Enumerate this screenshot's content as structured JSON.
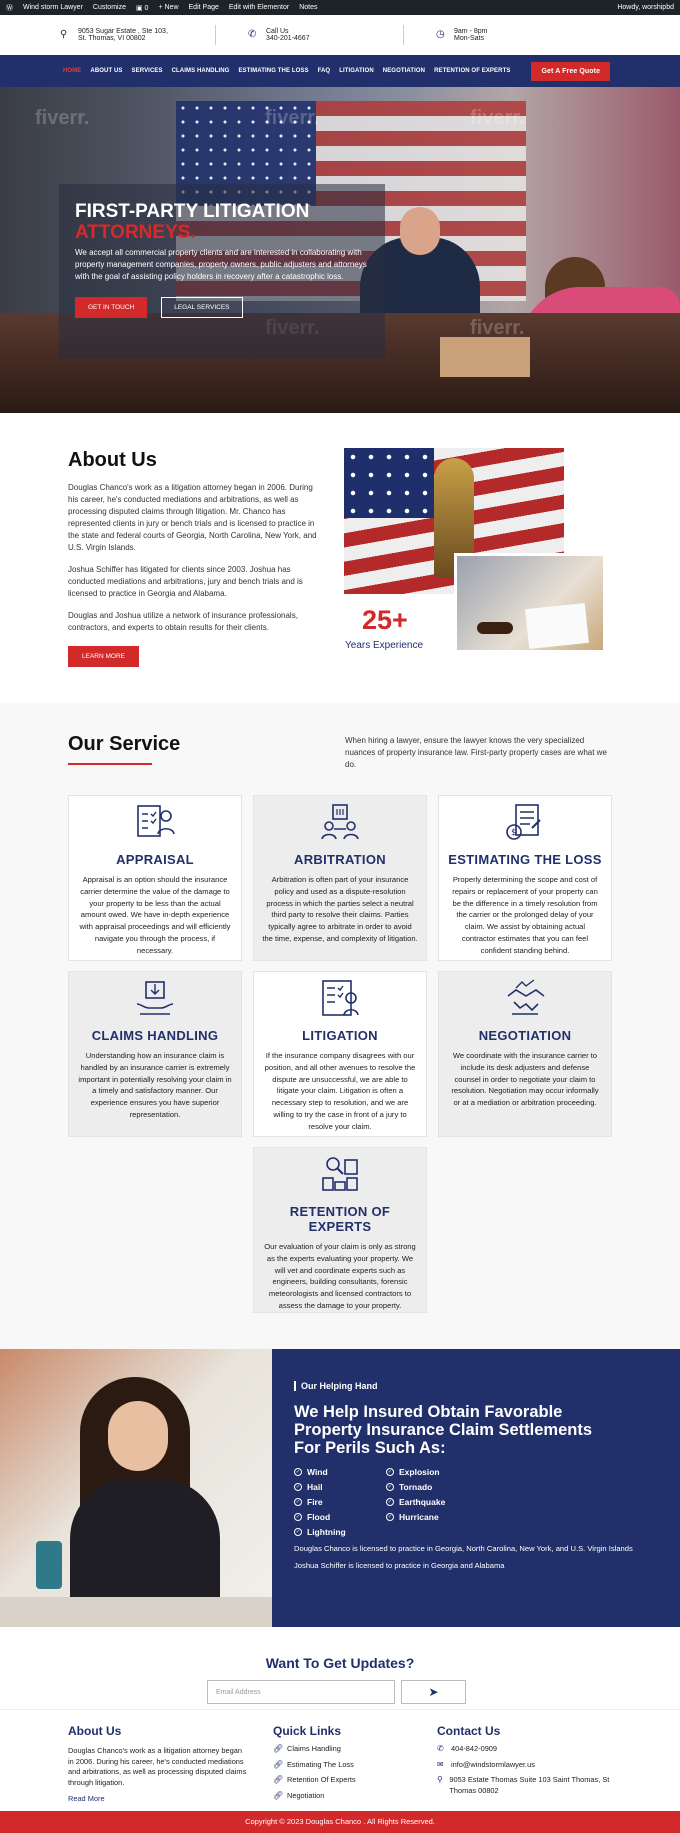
{
  "admin_bar": {
    "site_name": "Wind storm Lawyer",
    "customize": "Customize",
    "comments_count": "0",
    "new": "New",
    "edit_page": "Edit Page",
    "elementor": "Edit with Elementor",
    "notes": "Notes",
    "greeting": "Howdy, worshipbd"
  },
  "topbar": {
    "address_line1": "9053 Sugar Estate , Ste 103,",
    "address_line2": "St. Thomas, VI 00802",
    "call_label": "Call Us",
    "phone": "340-201-4667",
    "hours_line1": "9am - 8pm",
    "hours_line2": "Mon-Sats"
  },
  "nav": {
    "items": [
      "HOME",
      "ABOUT US",
      "SERVICES",
      "CLAIMS HANDLING",
      "ESTIMATING THE LOSS",
      "FAQ",
      "LITIGATION",
      "NEGOTIATION",
      "RETENTION OF EXPERTS"
    ],
    "cta": "Get A Free Quote"
  },
  "hero": {
    "title_line1": "FIRST-PARTY LITIGATION",
    "title_line2": "ATTORNEYS.",
    "text": "We accept all commercial property clients and are interested in collaborating with property management companies, property owners, public adjusters and attorneys with the goal of assisting policy holders in recovery after a catastrophic loss.",
    "btn_primary": "GET IN TOUCH",
    "btn_secondary": "LEGAL SERVICES"
  },
  "about": {
    "title": "About Us",
    "p1": "Douglas Chanco's work as a litigation attorney began in 2006. During his career, he's conducted mediations and arbitrations, as well as processing disputed claims through litigation. Mr. Chanco has represented clients in jury or bench trials and is licensed to practice in the state and federal courts of Georgia, North Carolina, New York, and U.S. Virgin Islands.",
    "p2": "Joshua Schiffer has litigated for clients since 2003. Joshua has conducted mediations and arbitrations, jury and bench trials and is licensed to practice in Georgia and Alabama.",
    "p3": "Douglas and Joshua utilize a network of insurance professionals, contractors, and experts to obtain results for their clients.",
    "button": "LEARN MORE",
    "years_number": "25+",
    "years_label": "Years Experience"
  },
  "services": {
    "title": "Our Service",
    "intro": "When hiring a lawyer, ensure the lawyer knows the very specialized nuances of property insurance law. First-party property cases are what we do.",
    "cards": [
      {
        "title": "APPRAISAL",
        "icon": "appraisal-icon",
        "text": "Appraisal is an option should the insurance carrier determine the value of the damage to your property to be less than the actual amount owed. We have in-depth experience with appraisal proceedings and will efficiently navigate you through the process, if necessary."
      },
      {
        "title": "ARBITRATION",
        "icon": "arbitration-icon",
        "text": "Arbitration is often part of your insurance policy and used as a dispute-resolution process in which the parties select a neutral third party to resolve their claims. Parties typically agree to arbitrate in order to avoid the time, expense, and complexity of litigation."
      },
      {
        "title": "ESTIMATING THE LOSS",
        "icon": "estimate-icon",
        "text": "Properly determining the scope and cost of repairs or replacement of your property can be the difference in a timely resolution from the carrier or the prolonged delay of your claim. We assist by obtaining actual contractor estimates that you can feel confident standing behind."
      },
      {
        "title": "CLAIMS HANDLING",
        "icon": "claims-icon",
        "text": "Understanding how an insurance claim is handled by an insurance carrier is extremely important in potentially resolving your claim in a timely and satisfactory manner. Our experience ensures you have superior representation."
      },
      {
        "title": "LITIGATION",
        "icon": "litigation-icon",
        "text": "If the insurance company disagrees with our position, and all other avenues to resolve the dispute are unsuccessful, we are able to litigate your claim. Litigation is often a necessary step to resolution, and we are willing to try the case in front of a jury to resolve your claim."
      },
      {
        "title": "NEGOTIATION",
        "icon": "negotiation-icon",
        "text": "We coordinate with the insurance carrier to include its desk adjusters and defense counsel in order to negotiate your claim to resolution. Negotiation may occur informally or at a mediation or arbitration proceeding."
      },
      {
        "title": "RETENTION OF EXPERTS",
        "icon": "experts-icon",
        "text": "Our evaluation of your claim is only as strong as the experts evaluating your property. We will vet and coordinate experts such as engineers, building consultants, forensic meteorologists and licensed contractors to assess the damage to your property."
      }
    ]
  },
  "helping": {
    "eyebrow": "Our Helping Hand",
    "title": "We Help Insured Obtain Favorable Property Insurance Claim Settlements For Perils Such As:",
    "perils": [
      "Wind",
      "Explosion",
      "Hail",
      "Tornado",
      "Fire",
      "Earthquake",
      "Flood",
      "Hurricane",
      "Lightning"
    ],
    "note1": "Douglas Chanco is licensed to practice in Georgia, North Carolina, New York, and U.S. Virgin Islands",
    "note2": "Joshua Schiffer is licensed to practice in Georgia and Alabama"
  },
  "updates": {
    "title": "Want To Get Updates?",
    "placeholder": "Email Address"
  },
  "footer": {
    "about_title": "About Us",
    "about_text": "Douglas Chanco's work as a litigation attorney began in 2006. During his career, he's conducted mediations and arbitrations, as well as processing disputed claims through litigation.",
    "read_more": "Read More",
    "links_title": "Quick Links",
    "links": [
      "Claims Handling",
      "Estimating The Loss",
      "Retention Of Experts",
      "Negotiation"
    ],
    "contact_title": "Contact Us",
    "contact_phone": "404-842-0909",
    "contact_email": "info@windstormlawyer.us",
    "contact_address": "9053 Estate Thomas Suite 103 Saint Thomas, St Thomas 00802",
    "copyright": "Copyright © 2023 Douglas Chanco . All Rights Reserved."
  },
  "colors": {
    "navy": "#21306b",
    "red": "#d22a2a"
  }
}
